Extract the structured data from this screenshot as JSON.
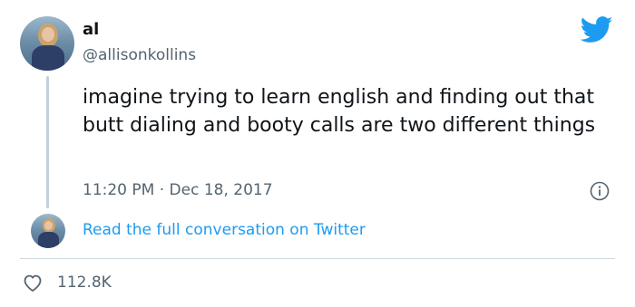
{
  "user": {
    "display_name": "al",
    "handle": "@allisonkollins"
  },
  "tweet": {
    "text": "imagine trying to learn english and finding out that butt dialing and booty calls are two different things",
    "timestamp": "11:20 PM · Dec 18, 2017"
  },
  "conversation": {
    "link_label": "Read the full conversation on Twitter"
  },
  "engagement": {
    "likes": "112.8K"
  },
  "icons": {
    "brand": "twitter-bird-icon",
    "info": "info-icon",
    "like": "heart-icon"
  },
  "colors": {
    "brand_blue": "#1d9bf0",
    "secondary_text": "#536471",
    "primary_text": "#0f1419"
  }
}
